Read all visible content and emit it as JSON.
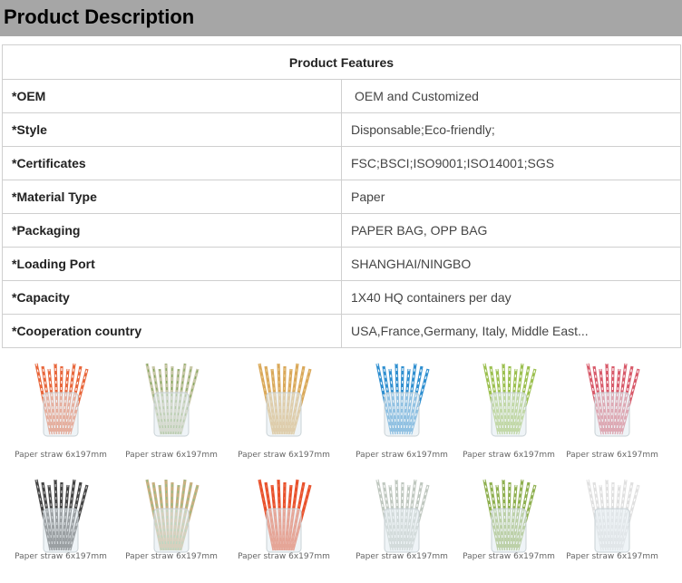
{
  "page": {
    "title": "Product Description"
  },
  "features": {
    "heading": "Product Features",
    "rows": [
      {
        "key": "*OEM",
        "value": "OEM and Customized"
      },
      {
        "key": "*Style",
        "value": "Disponsable;Eco-friendly;"
      },
      {
        "key": "*Certificates",
        "value": "FSC;BSCI;ISO9001;ISO14001;SGS"
      },
      {
        "key": "*Material Type",
        "value": "Paper"
      },
      {
        "key": "*Packaging",
        "value": "PAPER BAG, OPP BAG"
      },
      {
        "key": "*Loading Port",
        "value": "SHANGHAI/NINGBO"
      },
      {
        "key": "*Capacity",
        "value": "1X40 HQ containers per day"
      },
      {
        "key": "*Cooperation country",
        "value": "USA,France,Germany, Italy, Middle East..."
      }
    ]
  },
  "gallery": {
    "items": [
      {
        "caption": "Paper straw 6x197mm",
        "color": "#e8673c",
        "stripe": "#ffffff"
      },
      {
        "caption": "Paper straw 6x197mm",
        "color": "#c8c8a8",
        "stripe": "#7fa65a"
      },
      {
        "caption": "Paper straw 6x197mm",
        "color": "#d9a85a",
        "stripe": "#e9c98a"
      },
      {
        "caption": "Paper straw 6x197mm",
        "color": "#2f8fd0",
        "stripe": "#ffffff"
      },
      {
        "caption": "Paper straw 6x197mm",
        "color": "#9cc050",
        "stripe": "#ffffff"
      },
      {
        "caption": "Paper straw 6x197mm",
        "color": "#d85a6a",
        "stripe": "#ffffff"
      },
      {
        "caption": "Paper straw 6x197mm",
        "color": "#444444",
        "stripe": "#bbbbbb"
      },
      {
        "caption": "Paper straw 6x197mm",
        "color": "#c8b080",
        "stripe": "#8fbf8a"
      },
      {
        "caption": "Paper straw 6x197mm",
        "color": "#e8502a",
        "stripe": "#f07050"
      },
      {
        "caption": "Paper straw 6x197mm",
        "color": "#c0c8c0",
        "stripe": "#ffffff"
      },
      {
        "caption": "Paper straw 6x197mm",
        "color": "#8fb050",
        "stripe": "#ffffff"
      },
      {
        "caption": "Paper straw 6x197mm",
        "color": "#e0e0e0",
        "stripe": "#ffffff"
      }
    ]
  }
}
